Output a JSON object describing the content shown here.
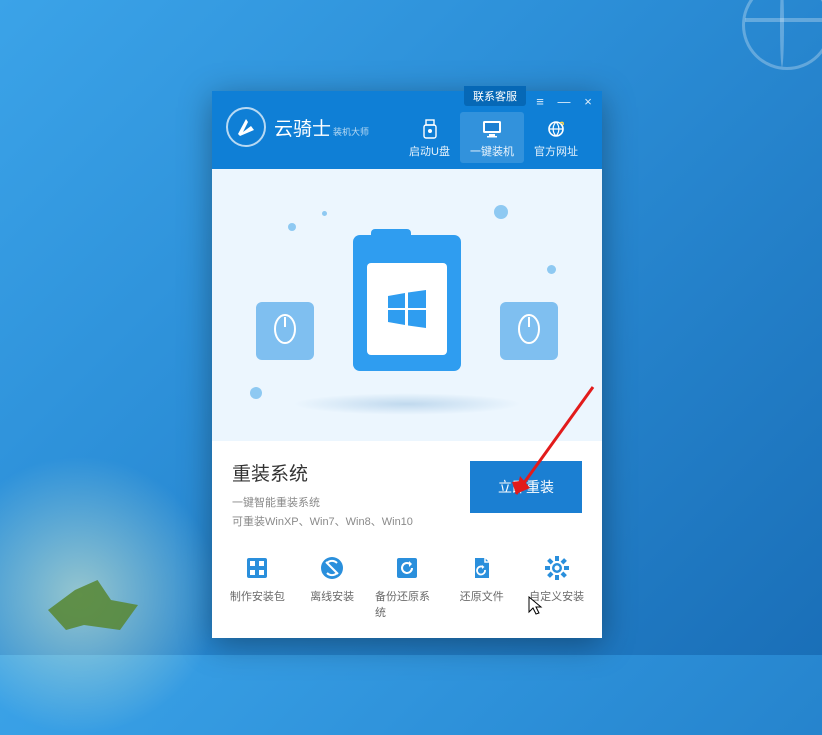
{
  "brand": {
    "name": "云骑士",
    "suffix": "装机大师"
  },
  "titlebar": {
    "contact": "联系客服",
    "menu": "≡",
    "minimize": "—",
    "close": "×"
  },
  "topTabs": [
    {
      "label": "启动U盘",
      "icon": "usb"
    },
    {
      "label": "一键装机",
      "icon": "monitor",
      "active": true
    },
    {
      "label": "官方网址",
      "icon": "globe"
    }
  ],
  "action": {
    "title": "重装系统",
    "subtitle1": "一键智能重装系统",
    "subtitle2": "可重装WinXP、Win7、Win8、Win10",
    "button": "立即重装"
  },
  "toolbar": [
    {
      "label": "制作安装包",
      "icon": "grid"
    },
    {
      "label": "离线安装",
      "icon": "offline"
    },
    {
      "label": "备份还原系统",
      "icon": "restore-sys"
    },
    {
      "label": "还原文件",
      "icon": "restore-file"
    },
    {
      "label": "自定义安装",
      "icon": "gear"
    }
  ]
}
